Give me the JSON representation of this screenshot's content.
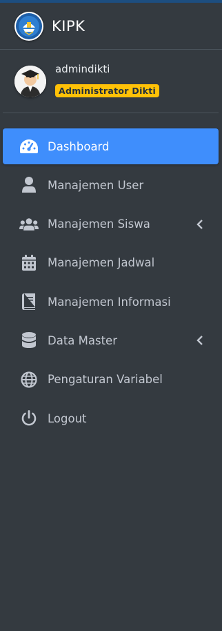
{
  "brand": {
    "title": "KIPK"
  },
  "user": {
    "name": "admindikti",
    "role": "Administrator Dikti"
  },
  "nav": [
    {
      "label": "Dashboard",
      "icon": "tachometer-icon",
      "active": true,
      "has_submenu": false
    },
    {
      "label": "Manajemen User",
      "icon": "user-icon",
      "active": false,
      "has_submenu": false
    },
    {
      "label": "Manajemen Siswa",
      "icon": "users-icon",
      "active": false,
      "has_submenu": true
    },
    {
      "label": "Manajemen Jadwal",
      "icon": "calendar-icon",
      "active": false,
      "has_submenu": false
    },
    {
      "label": "Manajemen Informasi",
      "icon": "book-icon",
      "active": false,
      "has_submenu": false
    },
    {
      "label": "Data Master",
      "icon": "database-icon",
      "active": false,
      "has_submenu": true
    },
    {
      "label": "Pengaturan Variabel",
      "icon": "globe-icon",
      "active": false,
      "has_submenu": false
    },
    {
      "label": "Logout",
      "icon": "power-icon",
      "active": false,
      "has_submenu": false
    }
  ],
  "colors": {
    "sidebar_bg": "#343a40",
    "active_bg": "#3f8efc",
    "badge_bg": "#ffc107",
    "text": "#c2c7d0"
  }
}
